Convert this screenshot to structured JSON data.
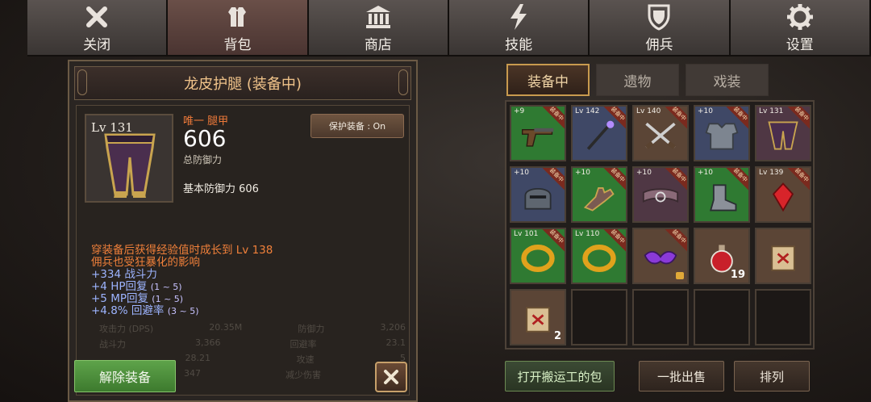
{
  "nav": [
    {
      "label": "关闭",
      "icon": "close-x-icon"
    },
    {
      "label": "背包",
      "icon": "armor-icon"
    },
    {
      "label": "商店",
      "icon": "shop-building-icon"
    },
    {
      "label": "技能",
      "icon": "lightning-icon"
    },
    {
      "label": "佣兵",
      "icon": "shield-icon"
    },
    {
      "label": "设置",
      "icon": "gear-icon"
    }
  ],
  "detail": {
    "title": "龙皮护腿 (装备中)",
    "level": "Lv 131",
    "rarity": "唯一 腿甲",
    "defense": "606",
    "defense_label": "总防御力",
    "base_defense": "基本防御力 606",
    "protect_button": "保护装备 : On",
    "growth_line1": "穿装备后获得经验值时成长到 Lv 138",
    "growth_line2": "佣兵也受狂暴化的影响",
    "stats": [
      {
        "main": "+334 战斗力",
        "range": ""
      },
      {
        "main": "+4 HP回复",
        "range": "(1 ~ 5)"
      },
      {
        "main": "+5 MP回复",
        "range": "(1 ~ 5)"
      },
      {
        "main": "+4.8% 回避率",
        "range": "(3 ~ 5)"
      }
    ],
    "unequip_button": "解除装备"
  },
  "tabs": [
    {
      "label": "装备中",
      "active": true
    },
    {
      "label": "遗物",
      "active": false
    },
    {
      "label": "戏装",
      "active": false
    }
  ],
  "equip_tag": "装备中",
  "inventory": [
    {
      "item": "pistol",
      "badge": "+9",
      "equipped": true,
      "bg": "green"
    },
    {
      "item": "staff",
      "badge": "Lv 142",
      "equipped": true,
      "bg": "blue"
    },
    {
      "item": "crossed-blades",
      "badge": "Lv 140",
      "equipped": true,
      "bg": "brown"
    },
    {
      "item": "chest-armor",
      "badge": "+10",
      "equipped": true,
      "bg": "blue"
    },
    {
      "item": "leg-armor",
      "badge": "Lv 131",
      "equipped": true,
      "bg": "purple"
    },
    {
      "item": "helmet",
      "badge": "+10",
      "equipped": true,
      "bg": "blue"
    },
    {
      "item": "gauntlet",
      "badge": "+10",
      "equipped": true,
      "bg": "green"
    },
    {
      "item": "belt",
      "badge": "+10",
      "equipped": true,
      "bg": "purple"
    },
    {
      "item": "boots",
      "badge": "+10",
      "equipped": true,
      "bg": "green"
    },
    {
      "item": "red-gem",
      "badge": "Lv 139",
      "equipped": true,
      "bg": "brown"
    },
    {
      "item": "gold-ring",
      "badge": "Lv 101",
      "equipped": true,
      "bg": "green"
    },
    {
      "item": "gold-ring",
      "badge": "Lv 110",
      "equipped": true,
      "bg": "green"
    },
    {
      "item": "purple-mask",
      "badge": "",
      "equipped": true,
      "bg": "brown",
      "locked": true
    },
    {
      "item": "red-potion",
      "badge": "",
      "equipped": false,
      "bg": "brown",
      "qty": "19"
    },
    {
      "item": "scroll",
      "badge": "",
      "equipped": false,
      "bg": "brown"
    },
    {
      "item": "scroll",
      "badge": "",
      "equipped": false,
      "bg": "brown",
      "qty": "2"
    },
    {
      "item": "",
      "badge": "",
      "equipped": false,
      "bg": "empty"
    },
    {
      "item": "",
      "badge": "",
      "equipped": false,
      "bg": "empty"
    },
    {
      "item": "",
      "badge": "",
      "equipped": false,
      "bg": "empty"
    },
    {
      "item": "",
      "badge": "",
      "equipped": false,
      "bg": "empty"
    }
  ],
  "bottom_buttons": {
    "porter": "打开搬运工的包",
    "bulk_sell": "一批出售",
    "sort": "排列"
  },
  "background_ghost": [
    [
      "攻击力 (DPS)",
      "20.35M",
      "防御力",
      "3,206"
    ],
    [
      "战斗力",
      "3,366",
      "回避率",
      "23.1"
    ],
    [
      "",
      "28.21",
      "攻速",
      "5"
    ],
    [
      "",
      "347",
      "减少伤害",
      ""
    ]
  ]
}
